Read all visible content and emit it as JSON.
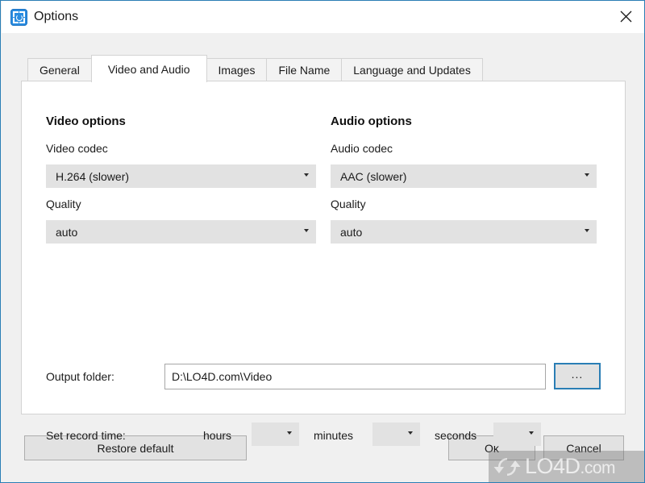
{
  "window": {
    "title": "Options",
    "app_icon": "screen-recorder-icon",
    "close_icon": "close-icon",
    "accent_color": "#2a7eb5"
  },
  "tabs": [
    {
      "label": "General",
      "active": false
    },
    {
      "label": "Video and Audio",
      "active": true
    },
    {
      "label": "Images",
      "active": false
    },
    {
      "label": "File Name",
      "active": false
    },
    {
      "label": "Language and Updates",
      "active": false
    }
  ],
  "video": {
    "section_title": "Video options",
    "codec_label": "Video codec",
    "codec_value": "H.264 (slower)",
    "quality_label": "Quality",
    "quality_value": "auto"
  },
  "audio": {
    "section_title": "Audio options",
    "codec_label": "Audio codec",
    "codec_value": "AAC (slower)",
    "quality_label": "Quality",
    "quality_value": "auto"
  },
  "output": {
    "label": "Output folder:",
    "value": "D:\\LO4D.com\\Video",
    "placeholder": "",
    "browse_label": "..."
  },
  "record_time": {
    "label": "Set record time:",
    "hours_label": "hours",
    "hours_value": "",
    "minutes_label": "minutes",
    "minutes_value": "",
    "seconds_label": "seconds",
    "seconds_value": ""
  },
  "footer": {
    "restore_default_label": "Restore default",
    "ok_label": "Ok",
    "cancel_label": "Cancel"
  },
  "watermark": {
    "text": "LO4D",
    "suffix": ".com"
  }
}
